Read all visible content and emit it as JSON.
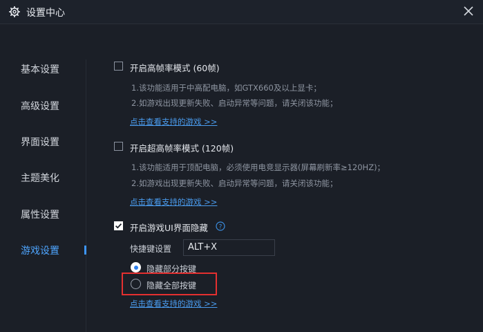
{
  "window": {
    "title": "设置中心",
    "close_icon": "close-icon",
    "settings_icon": "gear-icon"
  },
  "sidebar": {
    "items": [
      {
        "label": "基本设置",
        "active": false
      },
      {
        "label": "高级设置",
        "active": false
      },
      {
        "label": "界面设置",
        "active": false
      },
      {
        "label": "主题美化",
        "active": false
      },
      {
        "label": "属性设置",
        "active": false
      },
      {
        "label": "游戏设置",
        "active": true
      }
    ]
  },
  "options": {
    "high_fps": {
      "label": "开启高帧率模式 (60帧)",
      "checked": false,
      "desc1": "1.该功能适用于中高配电脑，如GTX660及以上显卡；",
      "desc2": "2.如游戏出现更新失败、启动异常等问题，请关闭该功能；",
      "link": "点击查看支持的游戏 >>"
    },
    "ultra_fps": {
      "label": "开启超高帧率模式 (120帧)",
      "checked": false,
      "desc1": "1.该功能适用于顶配电脑，必须使用电竞显示器(屏幕刷新率≥120HZ)；",
      "desc2": "2.如游戏出现更新失败、启动异常等问题，请关闭该功能；",
      "link": "点击查看支持的游戏 >>"
    },
    "hide_ui": {
      "label": "开启游戏UI界面隐藏",
      "checked": true,
      "help_icon": "question-icon",
      "hotkey_label": "快捷键设置",
      "hotkey_value": "ALT+X",
      "radio_partial": "隐藏部分按键",
      "radio_all": "隐藏全部按键",
      "selected": "partial",
      "link": "点击查看支持的游戏 >>"
    }
  },
  "colors": {
    "accent": "#4ea5ff",
    "link": "#4a9cef",
    "highlight": "#e53030",
    "background": "#1b1f27"
  }
}
